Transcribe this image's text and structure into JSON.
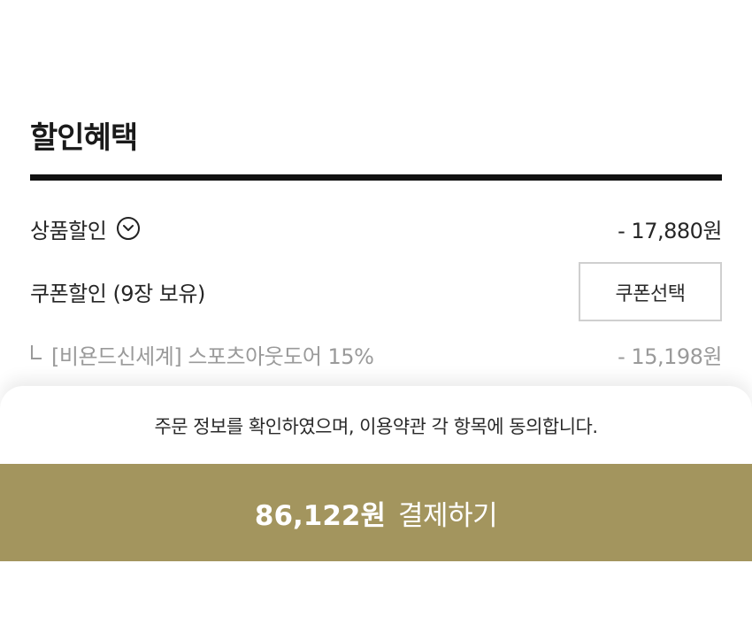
{
  "discount": {
    "title": "할인혜택",
    "product_discount": {
      "label": "상품할인",
      "amount": "- 17,880원"
    },
    "coupon_discount": {
      "label": "쿠폰할인 (9장 보유)",
      "button_label": "쿠폰선택"
    },
    "applied_coupon": {
      "label": "[비욘드신세계] 스포츠아웃도어 15%",
      "amount": "- 15,198원"
    }
  },
  "footer": {
    "agreement_text": "주문 정보를 확인하였으며, 이용약관 각 항목에 동의합니다.",
    "pay_amount": "86,122원",
    "pay_label": "결제하기",
    "button_color": "#a3955e"
  }
}
